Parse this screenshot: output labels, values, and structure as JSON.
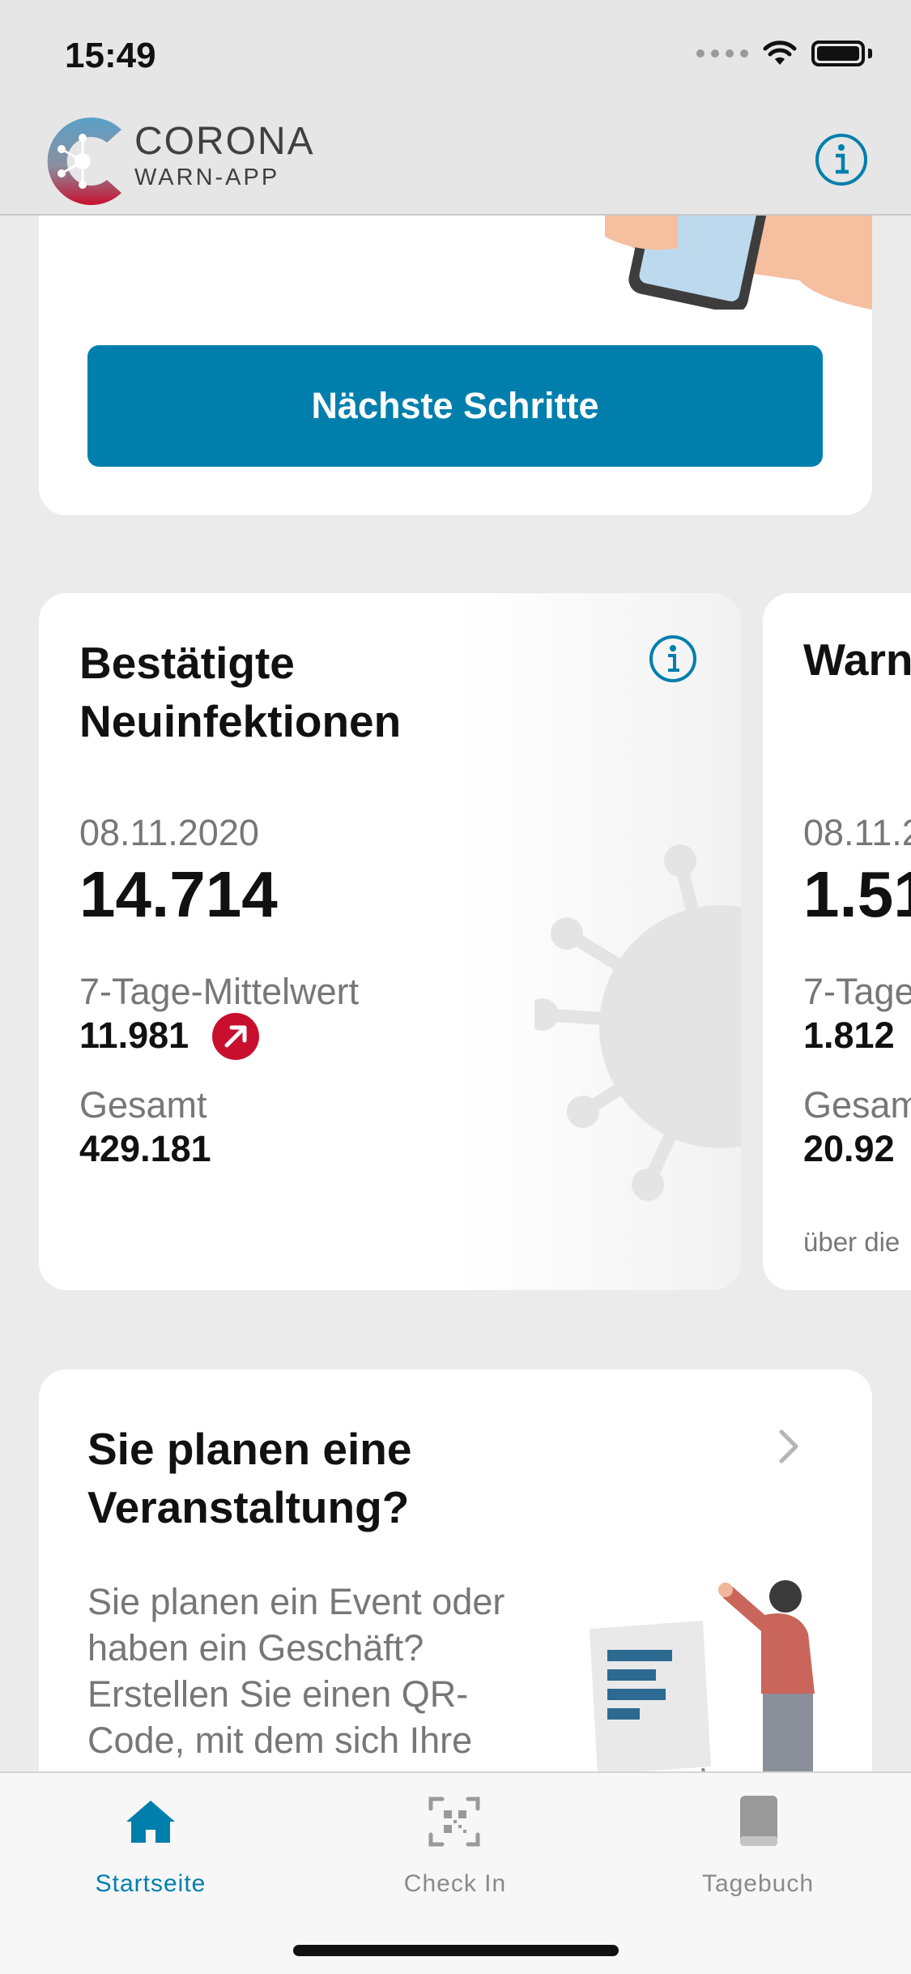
{
  "status_bar": {
    "time": "15:49"
  },
  "header": {
    "logo_line1": "CORONA",
    "logo_line2": "WARN-APP",
    "info_icon": "info-icon"
  },
  "risk_card": {
    "button_label": "Nächste Schritte"
  },
  "stats_card": {
    "title_line1": "Bestätigte",
    "title_line2": "Neuinfektionen",
    "date": "08.11.2020",
    "value": "14.714",
    "avg_label": "7-Tage-Mittelwert",
    "avg_value": "11.981",
    "trend_icon": "trend-up-arrow-icon",
    "total_label": "Gesamt",
    "total_value": "429.181"
  },
  "stats_card_2": {
    "title": "Warn",
    "date": "08.11.2",
    "value": "1.51",
    "avg_label": "7-Tage",
    "avg_value": "1.812",
    "total_label": "Gesam",
    "total_value": "20.92",
    "footnote": "über die"
  },
  "event_card": {
    "title_line1": "Sie planen eine",
    "title_line2": "Veranstaltung?",
    "body": "Sie planen ein Event oder haben ein Geschäft? Erstellen Sie einen QR-Code, mit dem sich Ihre Gäste bei"
  },
  "tab_bar": {
    "items": [
      {
        "label": "Startseite",
        "icon": "home-icon",
        "active": true
      },
      {
        "label": "Check In",
        "icon": "qr-code-icon",
        "active": false
      },
      {
        "label": "Tagebuch",
        "icon": "book-icon",
        "active": false
      }
    ]
  },
  "colors": {
    "accent": "#007fad",
    "trend_red": "#c8102e",
    "background": "#ebebeb"
  }
}
